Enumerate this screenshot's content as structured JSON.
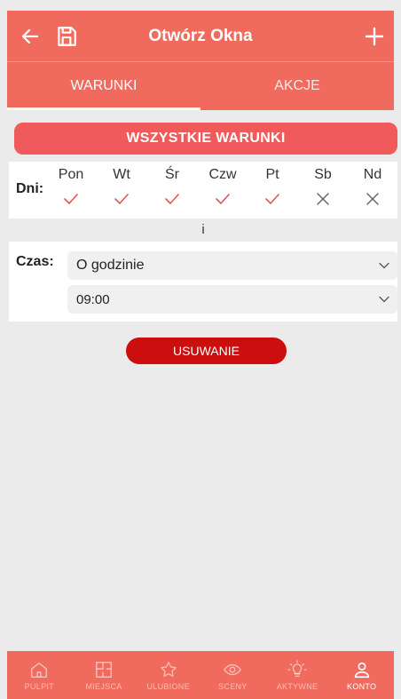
{
  "header": {
    "title": "Otwórz Okna",
    "back_icon": "arrow-left-icon",
    "save_icon": "floppy-disk-icon",
    "add_icon": "plus-icon"
  },
  "tabs": [
    {
      "label": "WARUNKI",
      "active": true
    },
    {
      "label": "AKCJE",
      "active": false
    }
  ],
  "all_conditions_button": "WSZYSTKIE WARUNKI",
  "days": {
    "label": "Dni:",
    "items": [
      {
        "name": "Pon",
        "selected": true
      },
      {
        "name": "Wt",
        "selected": true
      },
      {
        "name": "Śr",
        "selected": true
      },
      {
        "name": "Czw",
        "selected": true
      },
      {
        "name": "Pt",
        "selected": true
      },
      {
        "name": "Sb",
        "selected": false
      },
      {
        "name": "Nd",
        "selected": false
      }
    ]
  },
  "conjunction": "i",
  "time": {
    "label": "Czas:",
    "mode": "O godzinie",
    "value": "09:00"
  },
  "delete_button": "USUWANIE",
  "bottom_nav": [
    {
      "label": "PULPIT",
      "icon": "home-icon",
      "active": false
    },
    {
      "label": "MIEJSCA",
      "icon": "floorplan-icon",
      "active": false
    },
    {
      "label": "ULUBIONE",
      "icon": "star-icon",
      "active": false
    },
    {
      "label": "SCENY",
      "icon": "eye-icon",
      "active": false
    },
    {
      "label": "AKTYWNE",
      "icon": "lightbulb-icon",
      "active": false
    },
    {
      "label": "KONTO",
      "icon": "user-icon",
      "active": true
    }
  ],
  "colors": {
    "accent": "#f06a5e",
    "button": "#f05a5a",
    "delete": "#cc0e0e",
    "check": "#e05555",
    "cross": "#666666"
  }
}
